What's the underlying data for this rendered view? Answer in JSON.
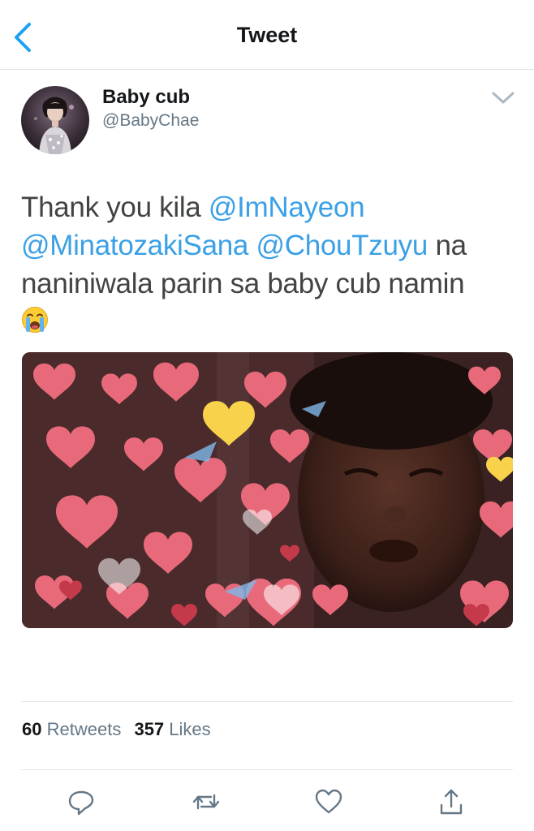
{
  "nav": {
    "title": "Tweet",
    "back_icon": "chevron-left-icon"
  },
  "author": {
    "name": "Baby cub",
    "handle": "@BabyChae"
  },
  "tweet": {
    "text_before": "Thank you kila ",
    "mention_1": "@ImNayeon",
    "mention_2": "@MinatozakiSana",
    "space": " ",
    "mention_3": "@ChouTzuyu",
    "text_after": " na naniniwala parin sa baby cub namin",
    "emoji": "loudly-crying-face"
  },
  "stats": {
    "retweets_count": "60",
    "retweets_label": "Retweets",
    "likes_count": "357",
    "likes_label": "Likes"
  },
  "actions": [
    "reply-icon",
    "retweet-icon",
    "like-icon",
    "share-icon"
  ],
  "colors": {
    "accent": "#1da1f2",
    "mention": "#3ba0e6",
    "secondary_text": "#657786",
    "divider": "#e1e8ed"
  }
}
